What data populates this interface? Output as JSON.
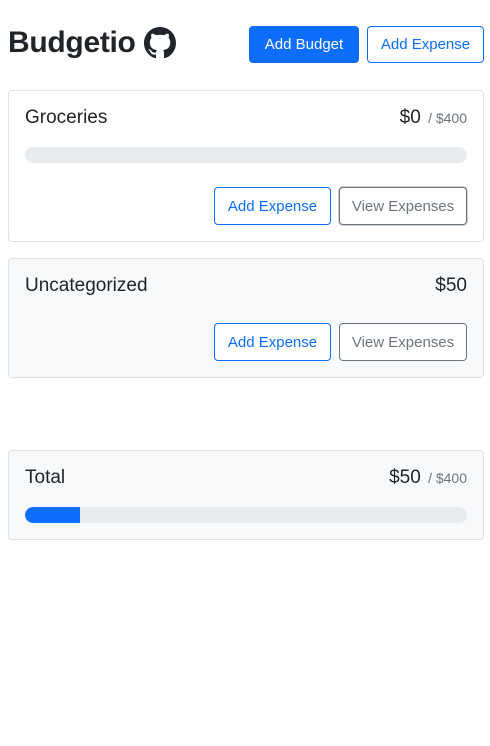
{
  "header": {
    "title": "Budgetio",
    "github_icon": "github-icon",
    "add_budget_label": "Add Budget",
    "add_expense_label": "Add Expense"
  },
  "budgets": [
    {
      "name": "Groceries",
      "amount": "$0",
      "max": "/ $400",
      "progress_fraction": 0.0,
      "add_expense_label": "Add Expense",
      "view_expenses_label": "View Expenses"
    },
    {
      "name": "Uncategorized",
      "amount": "$50",
      "add_expense_label": "Add Expense",
      "view_expenses_label": "View Expenses"
    }
  ],
  "total": {
    "name": "Total",
    "amount": "$50",
    "max": "/ $400",
    "progress_fraction": 0.125
  },
  "colors": {
    "primary": "#0d6efd",
    "secondary": "#6c757d",
    "track": "#e9ecef",
    "light_card": "#f8f9fa"
  }
}
